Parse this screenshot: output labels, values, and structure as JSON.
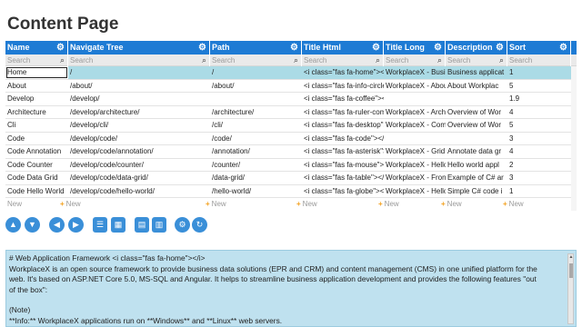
{
  "page": {
    "title": "Content Page"
  },
  "grid": {
    "columns": [
      {
        "label": "Name"
      },
      {
        "label": "Navigate Tree"
      },
      {
        "label": "Path"
      },
      {
        "label": "Title Html"
      },
      {
        "label": "Title Long"
      },
      {
        "label": "Description"
      },
      {
        "label": "Sort"
      }
    ],
    "search_placeholder": "Search",
    "rows": [
      {
        "name": "Home",
        "nav": "/",
        "path": "/",
        "html": "<i class=\"fas fa-home\"></i>",
        "title_long": "WorkplaceX - Business Application Framework",
        "desc": "Business applicat",
        "sort": "1"
      },
      {
        "name": "About",
        "nav": "/about/",
        "path": "/about/",
        "html": "<i class=\"fas fa-info-circle\"></i>",
        "title_long": "WorkplaceX - About",
        "desc": "About Workplac",
        "sort": "5"
      },
      {
        "name": "Develop",
        "nav": "/develop/",
        "path": "",
        "html": "<i class=\"fas fa-coffee\"></i>",
        "title_long": "",
        "desc": "",
        "sort": "1.9"
      },
      {
        "name": "Architecture",
        "nav": "/develop/architecture/",
        "path": "/architecture/",
        "html": "<i class=\"fas fa-ruler-combined\"></i>",
        "title_long": "WorkplaceX - Architecture",
        "desc": "Overview of Wor",
        "sort": "4"
      },
      {
        "name": "Cli",
        "nav": "/develop/cli/",
        "path": "/cli/",
        "html": "<i class=\"fas fa-desktop\"></i>",
        "title_long": "WorkplaceX - Command Line Interface",
        "desc": "Overview of Wor",
        "sort": "5"
      },
      {
        "name": "Code",
        "nav": "/develop/code/",
        "path": "/code/",
        "html": "<i class=\"fas fa-code\"></i>",
        "title_long": "",
        "desc": "",
        "sort": "3"
      },
      {
        "name": "Code Annotation",
        "nav": "/develop/code/annotation/",
        "path": "/annotation/",
        "html": "<i class=\"fas fa-asterisk\"></i>",
        "title_long": "WorkplaceX - Grid Annotation",
        "desc": "Annotate data gr",
        "sort": "4"
      },
      {
        "name": "Code Counter",
        "nav": "/develop/code/counter/",
        "path": "/counter/",
        "html": "<i class=\"fas fa-mouse\"></i>",
        "title_long": "WorkplaceX - Hello World Counter",
        "desc": "Hello world appl",
        "sort": "2"
      },
      {
        "name": "Code Data Grid",
        "nav": "/develop/code/data-grid/",
        "path": "/data-grid/",
        "html": "<i class=\"fas fa-table\"></i>",
        "title_long": "WorkplaceX - Frontend Data Grid",
        "desc": "Example of C# ar",
        "sort": "3"
      },
      {
        "name": "Code Hello World",
        "nav": "/develop/code/hello-world/",
        "path": "/hello-world/",
        "html": "<i class=\"fas fa-globe\"></i>",
        "title_long": "WorkplaceX - Hello World",
        "desc": "Simple C# code i",
        "sort": "1"
      }
    ],
    "new_label": "New"
  },
  "toolbar": {
    "buttons": [
      {
        "icon": "chevron-up-icon"
      },
      {
        "icon": "chevron-down-icon"
      },
      {
        "icon": "chevron-left-icon"
      },
      {
        "icon": "chevron-right-icon"
      },
      {
        "icon": "list-icon"
      },
      {
        "icon": "grid-icon"
      },
      {
        "icon": "file-icon"
      },
      {
        "icon": "file-text-icon"
      },
      {
        "icon": "gear-icon"
      },
      {
        "icon": "refresh-icon"
      }
    ]
  },
  "detail": {
    "lines": [
      "# Web Application Framework <i class=\"fas fa-home\"></i>",
      "WorkplaceX is an open source framework to provide business data solutions (EPR and CRM) and content management (CMS) in one unified platform for the",
      "web. It's based on ASP.NET Core 5.0, MS-SQL and Angular. It helps to streamline business application development and provides the following features \"out",
      "of the box\":",
      "",
      "(Note)",
      "**Info:** WorkplaceX applications run on **Windows** and **Linux** web servers."
    ]
  }
}
